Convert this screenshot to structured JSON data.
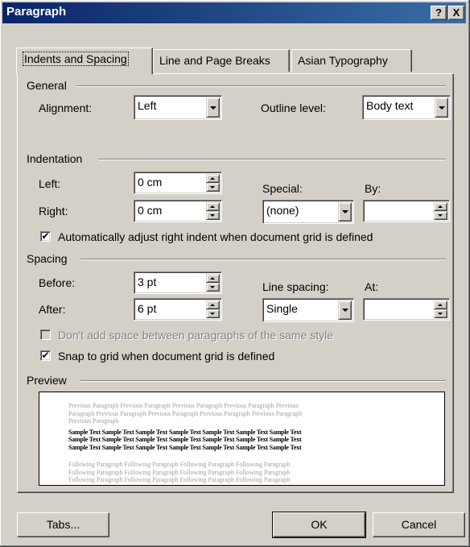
{
  "window": {
    "title": "Paragraph",
    "help_glyph": "?",
    "close_glyph": "X"
  },
  "tabs": [
    {
      "label": "Indents and Spacing",
      "selected": true
    },
    {
      "label": "Line and Page Breaks",
      "selected": false
    },
    {
      "label": "Asian Typography",
      "selected": false
    }
  ],
  "general": {
    "heading": "General",
    "alignment_label": "Alignment:",
    "alignment_value": "Left",
    "outline_label": "Outline level:",
    "outline_value": "Body text"
  },
  "indentation": {
    "heading": "Indentation",
    "left_label": "Left:",
    "left_value": "0 cm",
    "right_label": "Right:",
    "right_value": "0 cm",
    "special_label": "Special:",
    "special_value": "(none)",
    "by_label": "By:",
    "by_value": "",
    "auto_adjust_label": "Automatically adjust right indent when document grid is defined",
    "auto_adjust_checked": true
  },
  "spacing": {
    "heading": "Spacing",
    "before_label": "Before:",
    "before_value": "3 pt",
    "after_label": "After:",
    "after_value": "6 pt",
    "line_spacing_label": "Line spacing:",
    "line_spacing_value": "Single",
    "at_label": "At:",
    "at_value": "",
    "dont_add_label": "Don't add space between paragraphs of the same style",
    "dont_add_checked": false,
    "dont_add_enabled": false,
    "snap_label": "Snap to grid when document grid is defined",
    "snap_checked": true
  },
  "preview": {
    "heading": "Preview",
    "previous_lines": [
      "Previous Paragraph Previous Paragraph Previous Paragraph Previous Paragraph Previous",
      "Paragraph Previous Paragraph Previous Paragraph Previous Paragraph Previous Paragraph",
      "Previous Paragraph"
    ],
    "sample_lines": [
      "Sample Text Sample Text Sample Text Sample Text Sample Text Sample Text Sample Text",
      "Sample Text Sample Text Sample Text Sample Text Sample Text Sample Text Sample Text",
      "Sample Text Sample Text Sample Text Sample Text Sample Text Sample Text Sample Text"
    ],
    "following_lines": [
      "Following Paragraph Following Paragraph Following Paragraph Following Paragraph",
      "Following Paragraph Following Paragraph Following Paragraph Following Paragraph",
      "Following Paragraph Following Paragraph Following Paragraph Following Paragraph"
    ]
  },
  "buttons": {
    "tabs": "Tabs...",
    "ok": "OK",
    "cancel": "Cancel"
  }
}
